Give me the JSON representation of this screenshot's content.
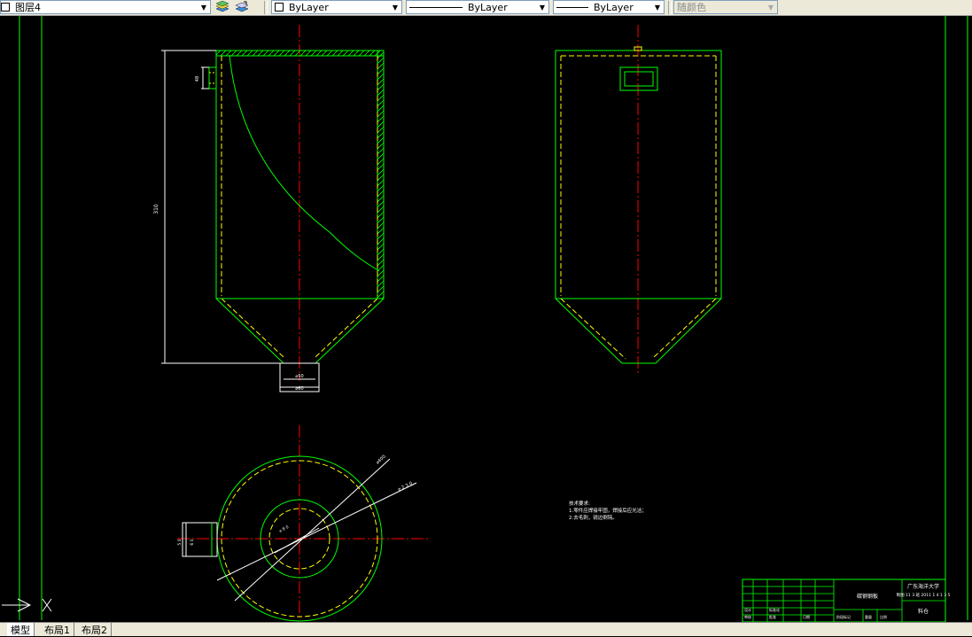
{
  "toolbar": {
    "layer_combo": {
      "value": "图层4",
      "checkbox": "☐",
      "arrow": "▼"
    },
    "layer_icons": [
      "layer-states-icon",
      "layer-previous-icon"
    ],
    "color_combo": {
      "value": "ByLayer",
      "arrow": "▼"
    },
    "linetype_combo": {
      "value": "ByLayer",
      "arrow": "▼"
    },
    "lineweight_combo": {
      "value": "ByLayer",
      "arrow": "▼"
    },
    "plotstyle_combo": {
      "value": "随颜色",
      "arrow": "▼"
    }
  },
  "drawing": {
    "colors": {
      "background": "#000000",
      "outline": "#00ff00",
      "hidden_line": "#ffff00",
      "center_line": "#ff0000",
      "dimension": "#ffffff"
    },
    "front_view": {
      "height_dim": "310",
      "outlet_inner_dim": "⌀50",
      "outlet_outer_dim": "⌀60",
      "nozzle_dim": "48"
    },
    "top_view": {
      "outer_dim": "⌀400",
      "inner_dim": "⌀ 2 3 0",
      "center_dim": "⌀ 8 0",
      "nozzle_dim_a": "5 0",
      "nozzle_dim_b": "6 0"
    },
    "notes": {
      "title": "技术要求:",
      "line1": "1.零件应焊接牢固，焊接后应光洁；",
      "line2": "2.去毛刺，锐边倒钝。"
    },
    "title_block": {
      "school": "广东海洋大学",
      "student": "制图 11 3 班 2011 1 4 1 3 5",
      "part_name": "料仓",
      "material": "碳钢钢板",
      "scale_label": "比例",
      "sheet_label": "共 张 第 张",
      "weight_label": "重量",
      "qty_label": "数量",
      "cells": [
        "设计",
        "审核",
        "标准化",
        "批准",
        "日期",
        "阶段标记",
        "重量",
        "比例"
      ]
    }
  },
  "tabs": {
    "nav": "◀ ▶",
    "items": [
      "模型",
      "布局1",
      "布局2"
    ]
  }
}
